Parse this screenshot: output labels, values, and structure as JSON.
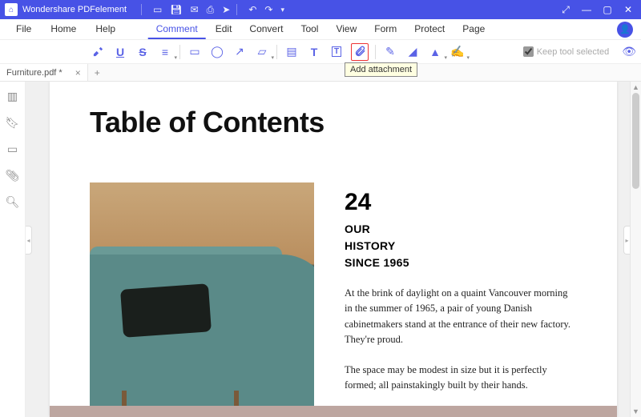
{
  "title": "Wondershare PDFelement",
  "menus": {
    "file": "File",
    "home": "Home",
    "help": "Help",
    "comment": "Comment",
    "edit": "Edit",
    "convert": "Convert",
    "tool": "Tool",
    "view": "View",
    "form": "Form",
    "protect": "Protect",
    "page": "Page"
  },
  "keep_tool": "Keep tool selected",
  "tooltip": "Add attachment",
  "tab": {
    "name": "Furniture.pdf *"
  },
  "doc": {
    "heading": "Table of Contents",
    "num": "24",
    "sub1": "OUR",
    "sub2": "HISTORY",
    "sub3": "SINCE 1965",
    "para1": "At the brink of daylight on a quaint Vancouver morning in the summer of 1965, a pair of young Danish cabinetmakers stand at the entrance of their new factory. They're proud.",
    "para2": "The space may be modest in size but it is perfectly formed; all painstakingly built by their hands."
  }
}
